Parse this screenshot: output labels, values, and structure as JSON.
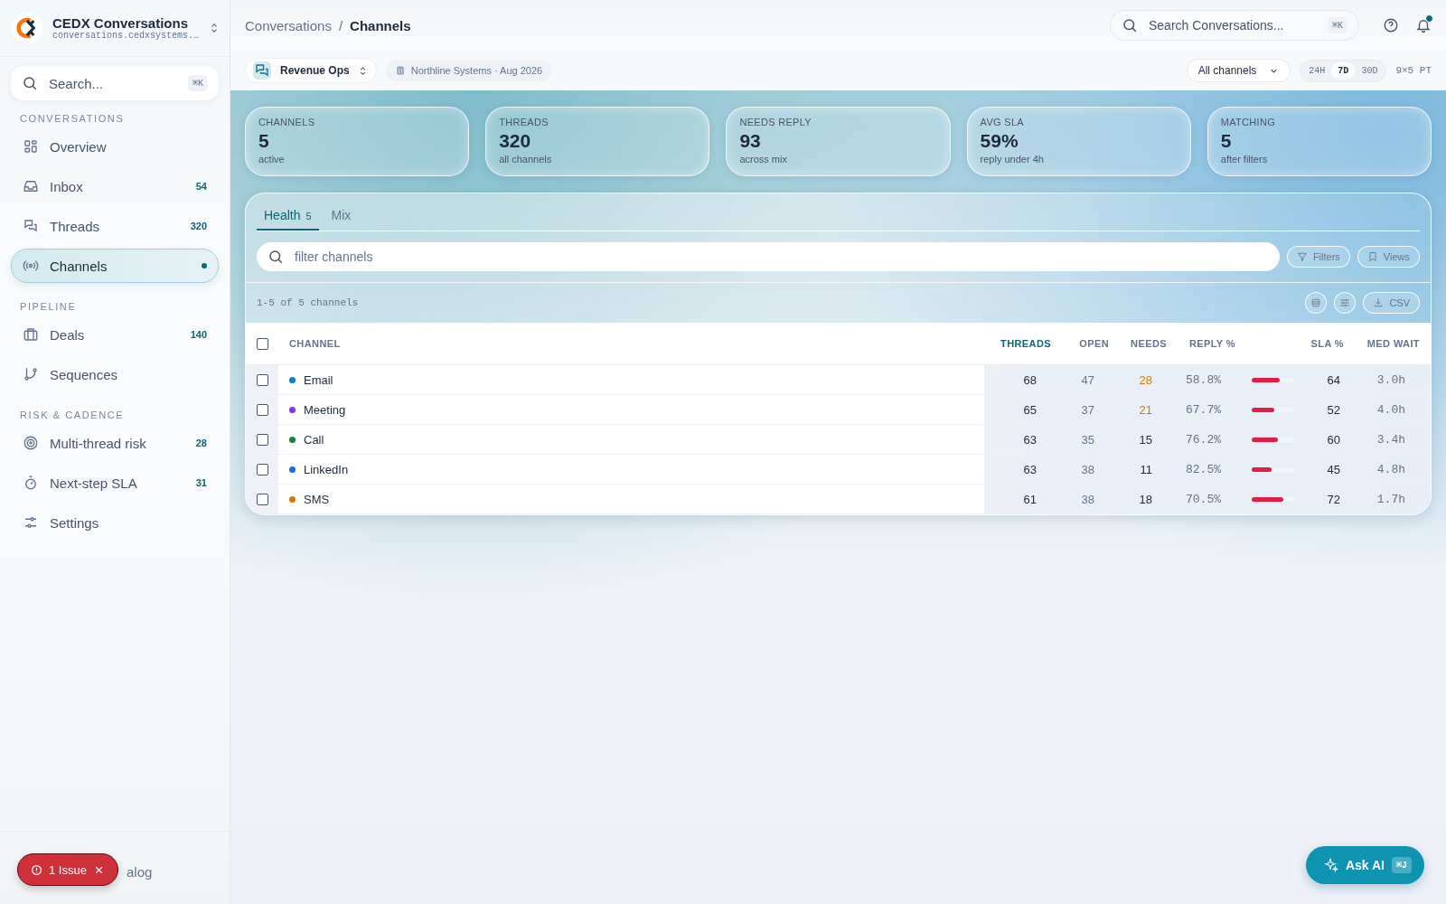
{
  "brand": {
    "name": "CEDX Conversations",
    "domain": "conversations.cedxsystems.…"
  },
  "sidebar": {
    "search": {
      "placeholder": "Search...",
      "shortcut": "⌘K"
    },
    "sections": [
      {
        "title": "CONVERSATIONS",
        "items": [
          {
            "label": "Overview",
            "selected": false
          },
          {
            "label": "Inbox",
            "count": "54",
            "selected": false
          },
          {
            "label": "Threads",
            "count": "320",
            "selected": false
          },
          {
            "label": "Channels",
            "selected": true
          }
        ]
      },
      {
        "title": "PIPELINE",
        "items": [
          {
            "label": "Deals",
            "count": "140",
            "selected": false
          },
          {
            "label": "Sequences",
            "selected": false
          }
        ]
      },
      {
        "title": "RISK & CADENCE",
        "items": [
          {
            "label": "Multi-thread risk",
            "count": "28",
            "selected": false
          },
          {
            "label": "Next-step SLA",
            "count": "31",
            "selected": false
          },
          {
            "label": "Settings",
            "selected": false
          }
        ]
      }
    ],
    "footer_link": "alog"
  },
  "issue_badge": {
    "label": "1 Issue"
  },
  "breadcrumb": {
    "parent": "Conversations",
    "separator": "/",
    "current": "Channels"
  },
  "top_search": {
    "placeholder": "Search Conversations...",
    "shortcut": "⌘K"
  },
  "notifications": {
    "unread": true
  },
  "workspace": {
    "name": "Revenue Ops",
    "org": "Northline Systems · Aug 2026"
  },
  "channel_filter": "All channels",
  "ranges": [
    {
      "label": "24H",
      "selected": false
    },
    {
      "label": "7D",
      "selected": true
    },
    {
      "label": "30D",
      "selected": false
    }
  ],
  "grid_info": "9×5 PT",
  "stats": [
    {
      "label": "CHANNELS",
      "value": "5",
      "sub": "active"
    },
    {
      "label": "THREADS",
      "value": "320",
      "sub": "all channels"
    },
    {
      "label": "NEEDS REPLY",
      "value": "93",
      "sub": "across mix"
    },
    {
      "label": "AVG SLA",
      "value": "59%",
      "sub": "reply under 4h"
    },
    {
      "label": "MATCHING",
      "value": "5",
      "sub": "after filters"
    }
  ],
  "tabs": [
    {
      "label": "Health",
      "count": "5",
      "selected": true
    },
    {
      "label": "Mix",
      "selected": false
    }
  ],
  "filter": {
    "placeholder": "filter channels"
  },
  "filter_buttons": [
    "Filters",
    "Views"
  ],
  "range_text": "1-5 of 5 channels",
  "csv_button": "CSV",
  "table": {
    "all_checked": false,
    "columns": [
      {
        "label": "CHANNEL",
        "sorted": false
      },
      {
        "label": "THREADS",
        "sorted": true
      },
      {
        "label": "OPEN",
        "sorted": false
      },
      {
        "label": "NEEDS",
        "sorted": false
      },
      {
        "label": "REPLY %",
        "sorted": false
      },
      {
        "label": "SLA %",
        "sorted": false
      },
      {
        "label": "MED WAIT",
        "sorted": false
      }
    ],
    "rows": [
      {
        "checked": false,
        "name": "Email",
        "color": "#0284c7",
        "threads": "68",
        "open": "47",
        "needs": "28",
        "needs_warn": true,
        "reply": "58.8%",
        "level": 0.64,
        "sla": "64",
        "wait": "3.0h"
      },
      {
        "checked": false,
        "name": "Meeting",
        "color": "#7c3aed",
        "threads": "65",
        "open": "37",
        "needs": "21",
        "needs_warn": true,
        "reply": "67.7%",
        "level": 0.52,
        "sla": "52",
        "wait": "4.0h"
      },
      {
        "checked": false,
        "name": "Call",
        "color": "#15803d",
        "threads": "63",
        "open": "35",
        "needs": "15",
        "needs_warn": false,
        "reply": "76.2%",
        "level": 0.6,
        "sla": "60",
        "wait": "3.4h"
      },
      {
        "checked": false,
        "name": "LinkedIn",
        "color": "#2563eb",
        "threads": "63",
        "open": "38",
        "needs": "11",
        "needs_warn": false,
        "reply": "82.5%",
        "level": 0.45,
        "sla": "45",
        "wait": "4.8h"
      },
      {
        "checked": false,
        "name": "SMS",
        "color": "#d97706",
        "threads": "61",
        "open": "38",
        "needs": "18",
        "needs_warn": false,
        "reply": "70.5%",
        "level": 0.72,
        "sla": "72",
        "wait": "1.7h"
      }
    ]
  },
  "ask_ai": {
    "label": "Ask AI",
    "shortcut": "⌘J"
  }
}
